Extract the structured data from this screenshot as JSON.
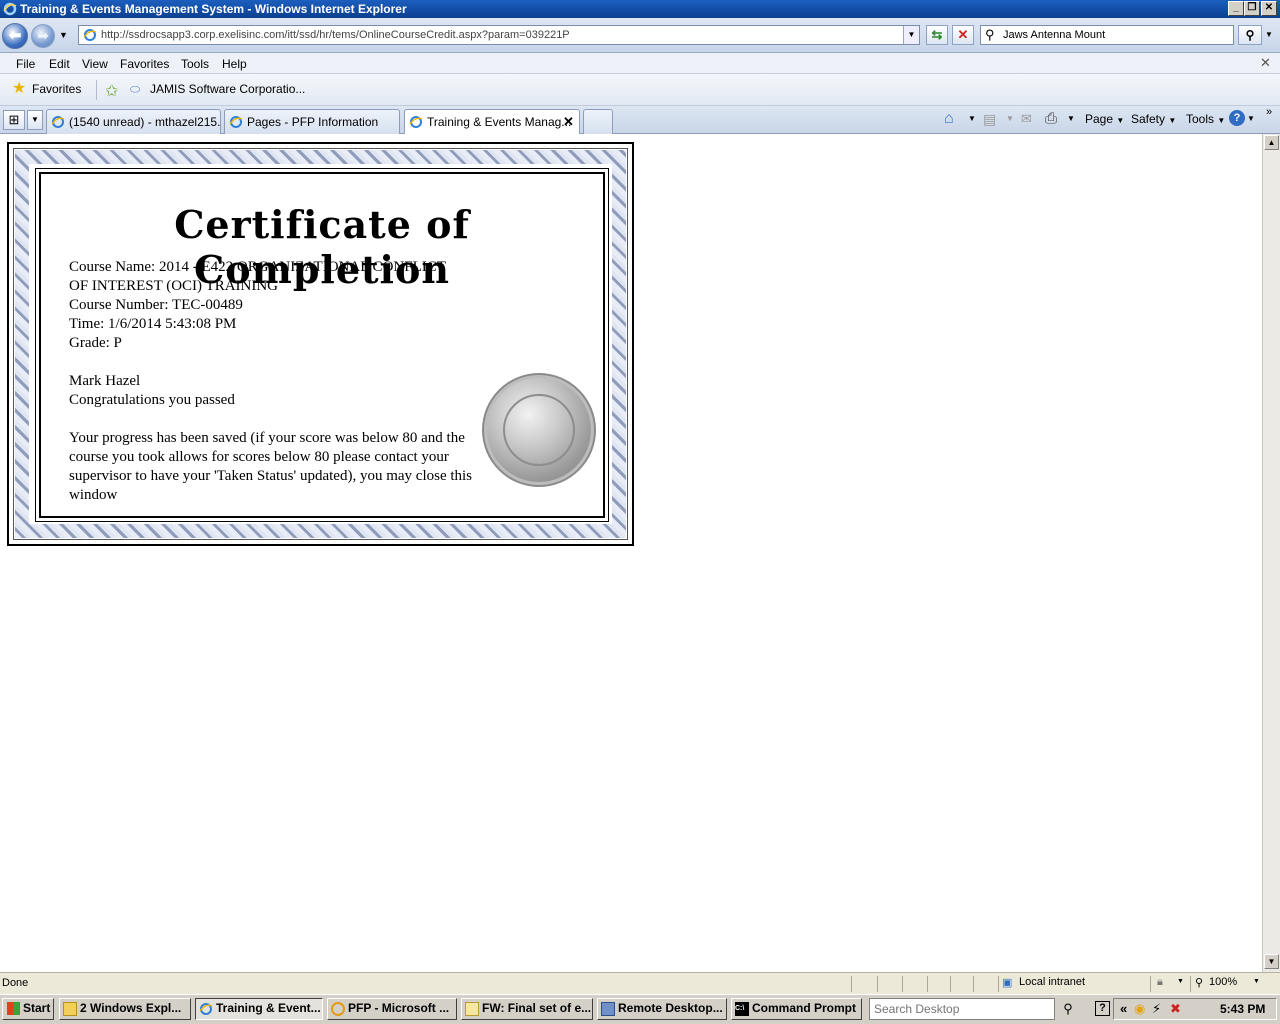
{
  "window": {
    "title": "Training & Events Management System - Windows Internet Explorer",
    "minimize": "0",
    "restore": "2",
    "close": "r"
  },
  "nav": {
    "address": "http://ssdrocsapp3.corp.exelisinc.com/itt/ssd/hr/tems/OnlineCourseCredit.aspx?param=039221P",
    "search_value": "Jaws Antenna Mount"
  },
  "menu": {
    "items": [
      "File",
      "Edit",
      "View",
      "Favorites",
      "Tools",
      "Help"
    ]
  },
  "favorites": {
    "label": "Favorites",
    "link": "JAMIS Software Corporatio..."
  },
  "tabs": [
    {
      "label": "(1540 unread) - mthazel215...",
      "active": false
    },
    {
      "label": "Pages - PFP Information",
      "active": false
    },
    {
      "label": "Training & Events Manag...",
      "active": true
    }
  ],
  "commandbar": {
    "page": "Page",
    "safety": "Safety",
    "tools": "Tools"
  },
  "certificate": {
    "title": "Certificate of Completion",
    "course_name_line1": "Course Name: 2014 - E422 ORGANIZATIONAL CONFLICT",
    "course_name_line2": "OF INTEREST (OCI) TRAINING",
    "course_number": "Course Number: TEC-00489",
    "time": "Time: 1/6/2014 5:43:08 PM",
    "grade": "Grade: P",
    "name": "Mark Hazel",
    "congrats": "Congratulations you passed",
    "progress_line1": "Your progress has been saved (if your score was below 80 and the",
    "progress_line2": "course you took allows for scores below 80 please contact your",
    "progress_line3": "supervisor to have your 'Taken Status' updated), you may close this",
    "progress_line4": "window"
  },
  "status": {
    "text": "Done",
    "zone": "Local intranet",
    "zoom": "100%"
  },
  "taskbar": {
    "start": "Start",
    "buttons": [
      {
        "label": "2 Windows Expl...",
        "pressed": false
      },
      {
        "label": "Training & Event...",
        "pressed": true
      },
      {
        "label": "PFP - Microsoft ...",
        "pressed": false
      },
      {
        "label": "FW: Final set of e...",
        "pressed": false
      },
      {
        "label": "Remote Desktop...",
        "pressed": false
      },
      {
        "label": "Command Prompt",
        "pressed": false
      }
    ],
    "search_placeholder": "Search Desktop",
    "clock": "5:43 PM"
  },
  "colors": {
    "titlebar": "#0b3f8f",
    "chrome": "#dfe7f3",
    "taskbar": "#d4d0c8",
    "rope": "#aab4cc"
  }
}
